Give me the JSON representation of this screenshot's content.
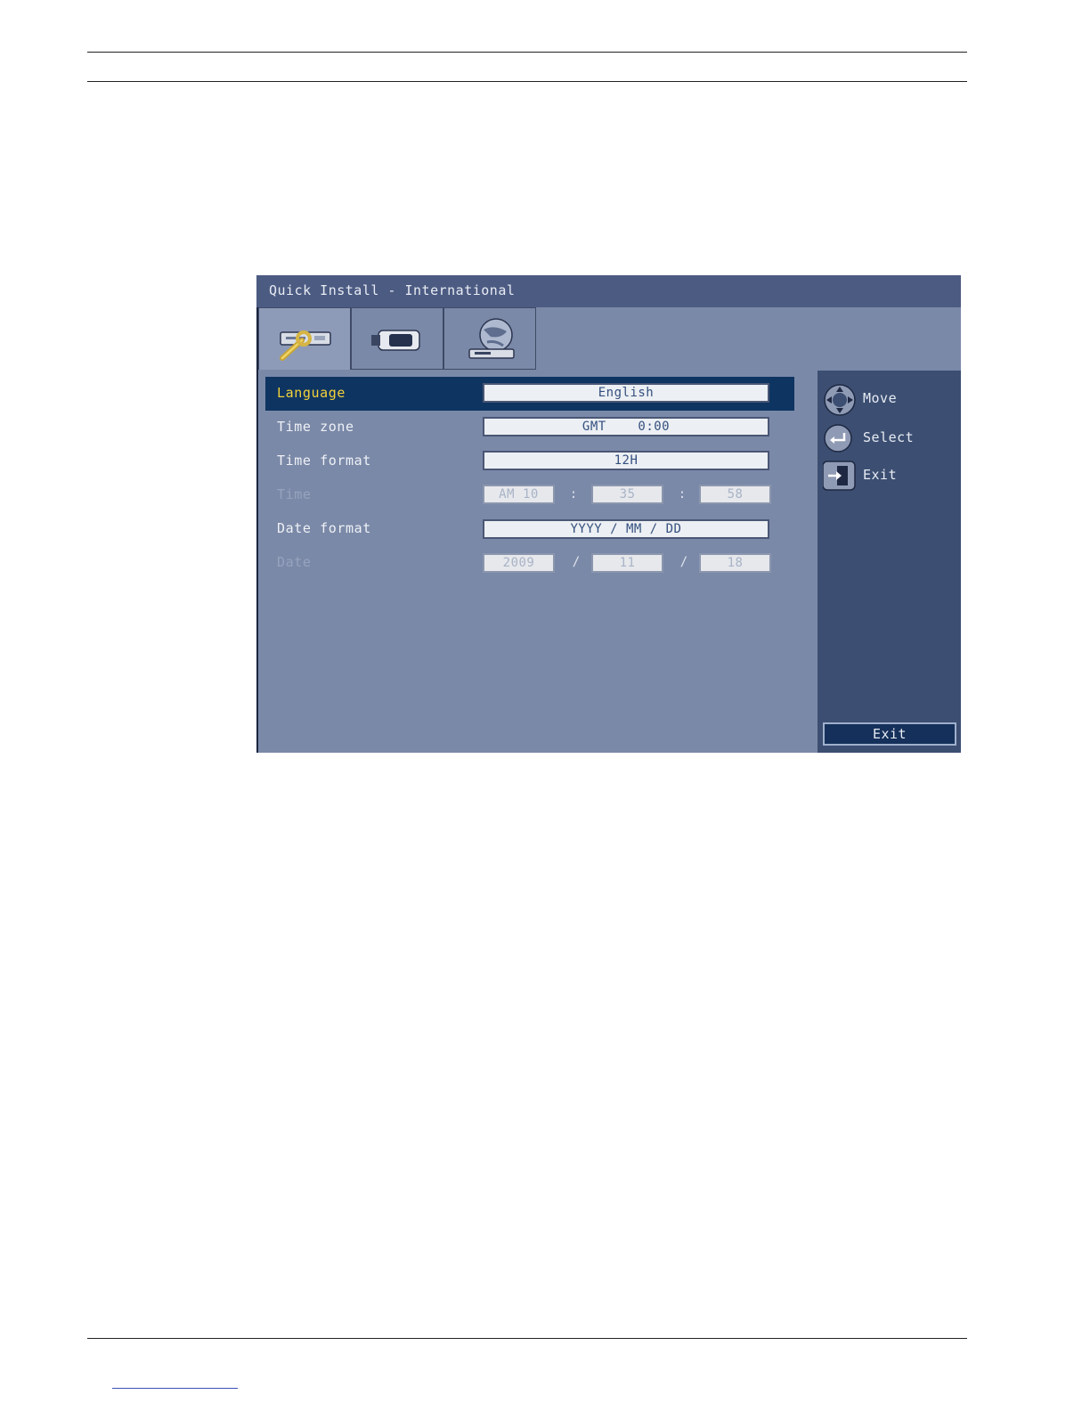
{
  "window": {
    "title": "Quick Install - International"
  },
  "tabs": [
    {
      "icon": "wrench-recorder-icon",
      "active": true
    },
    {
      "icon": "camera-icon",
      "active": false
    },
    {
      "icon": "globe-network-icon",
      "active": false
    }
  ],
  "settings": {
    "language": {
      "label": "Language",
      "value": "English"
    },
    "time_zone": {
      "label": "Time zone",
      "value": "GMT    0:00"
    },
    "time_format": {
      "label": "Time format",
      "value": "12H"
    },
    "time": {
      "label": "Time",
      "hour": "AM 10",
      "minute": "35",
      "second": "58",
      "separator": ":"
    },
    "date_format": {
      "label": "Date format",
      "value": "YYYY / MM / DD"
    },
    "date": {
      "label": "Date",
      "year": "2009",
      "month": "11",
      "day": "18",
      "separator": "/"
    }
  },
  "help": {
    "move": "Move",
    "select": "Select",
    "exit": "Exit"
  },
  "exit_button": "Exit",
  "colors": {
    "osd_background": "#7b89a8",
    "titlebar": "#4c5b82",
    "sidebar": "#3c4f72",
    "selected_row": "#0e3461",
    "selected_label": "#f2d23a"
  }
}
